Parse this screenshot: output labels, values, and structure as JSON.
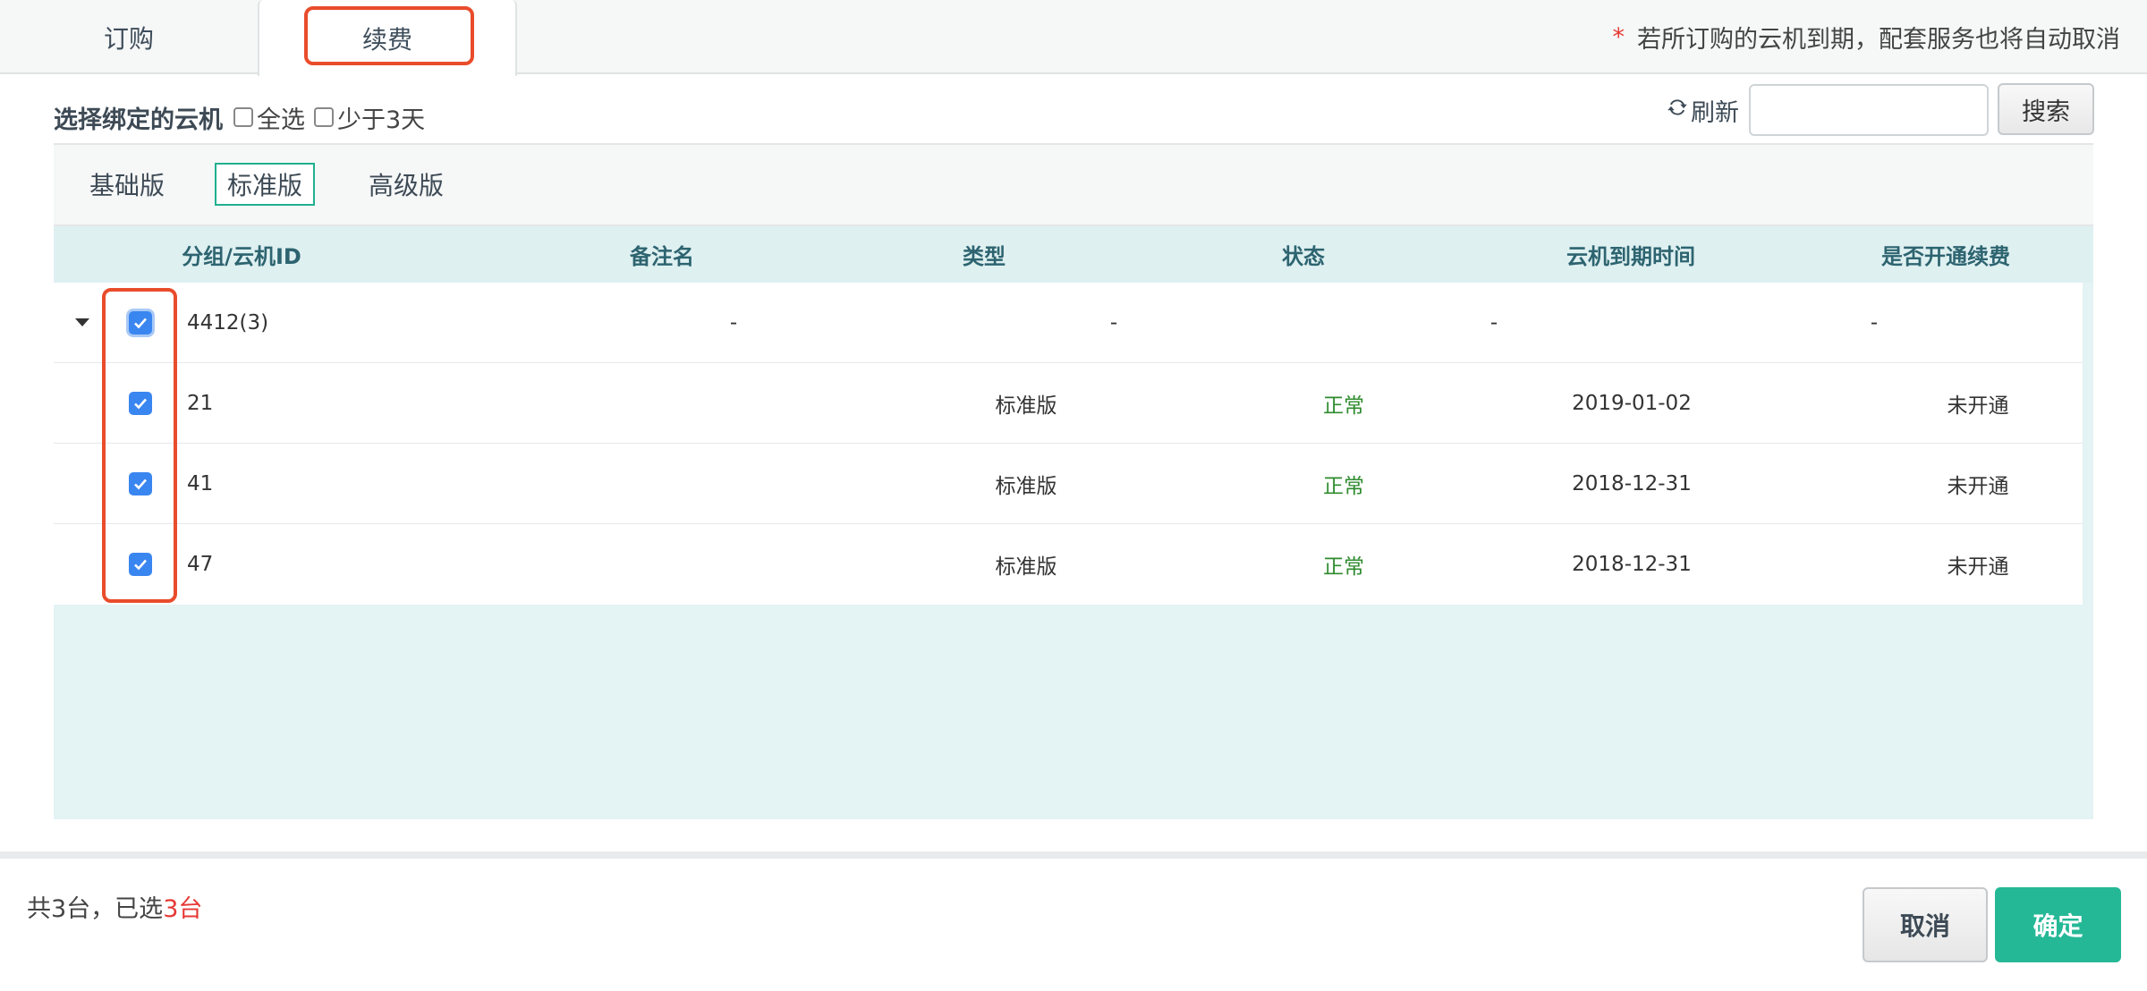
{
  "tabs": [
    {
      "label": "订购"
    },
    {
      "label": "续费"
    }
  ],
  "notice": {
    "star": "*",
    "text": "若所订购的云机到期，配套服务也将自动取消"
  },
  "select": {
    "title": "选择绑定的云机",
    "select_all_label": "全选",
    "less_than_3_days_label": "少于3天"
  },
  "toolbar": {
    "refresh_label": "刷新",
    "search_placeholder": "",
    "search_label": "搜索"
  },
  "editions": [
    {
      "label": "基础版"
    },
    {
      "label": "标准版",
      "selected": true
    },
    {
      "label": "高级版"
    }
  ],
  "table": {
    "columns": [
      "分组/云机ID",
      "备注名",
      "类型",
      "状态",
      "云机到期时间",
      "是否开通续费"
    ],
    "group": {
      "id": "4412(3)",
      "remark": "-",
      "type": "-",
      "expire": "-",
      "renew": "-",
      "checked": true
    },
    "rows": [
      {
        "id": "21",
        "remark": "",
        "type": "标准版",
        "status": "正常",
        "expire": "2019-01-02",
        "renew": "未开通",
        "checked": true
      },
      {
        "id": "41",
        "remark": "",
        "type": "标准版",
        "status": "正常",
        "expire": "2018-12-31",
        "renew": "未开通",
        "checked": true
      },
      {
        "id": "47",
        "remark": "",
        "type": "标准版",
        "status": "正常",
        "expire": "2018-12-31",
        "renew": "未开通",
        "checked": true
      }
    ]
  },
  "footer": {
    "total_text": "共3台，已选",
    "selected_count": "3台",
    "cancel_label": "取消",
    "confirm_label": "确定"
  },
  "colors": {
    "accent": "#25b896",
    "highlight": "#e94c2b",
    "status_ok": "#2e8b2e",
    "checkbox": "#3a86f0"
  }
}
